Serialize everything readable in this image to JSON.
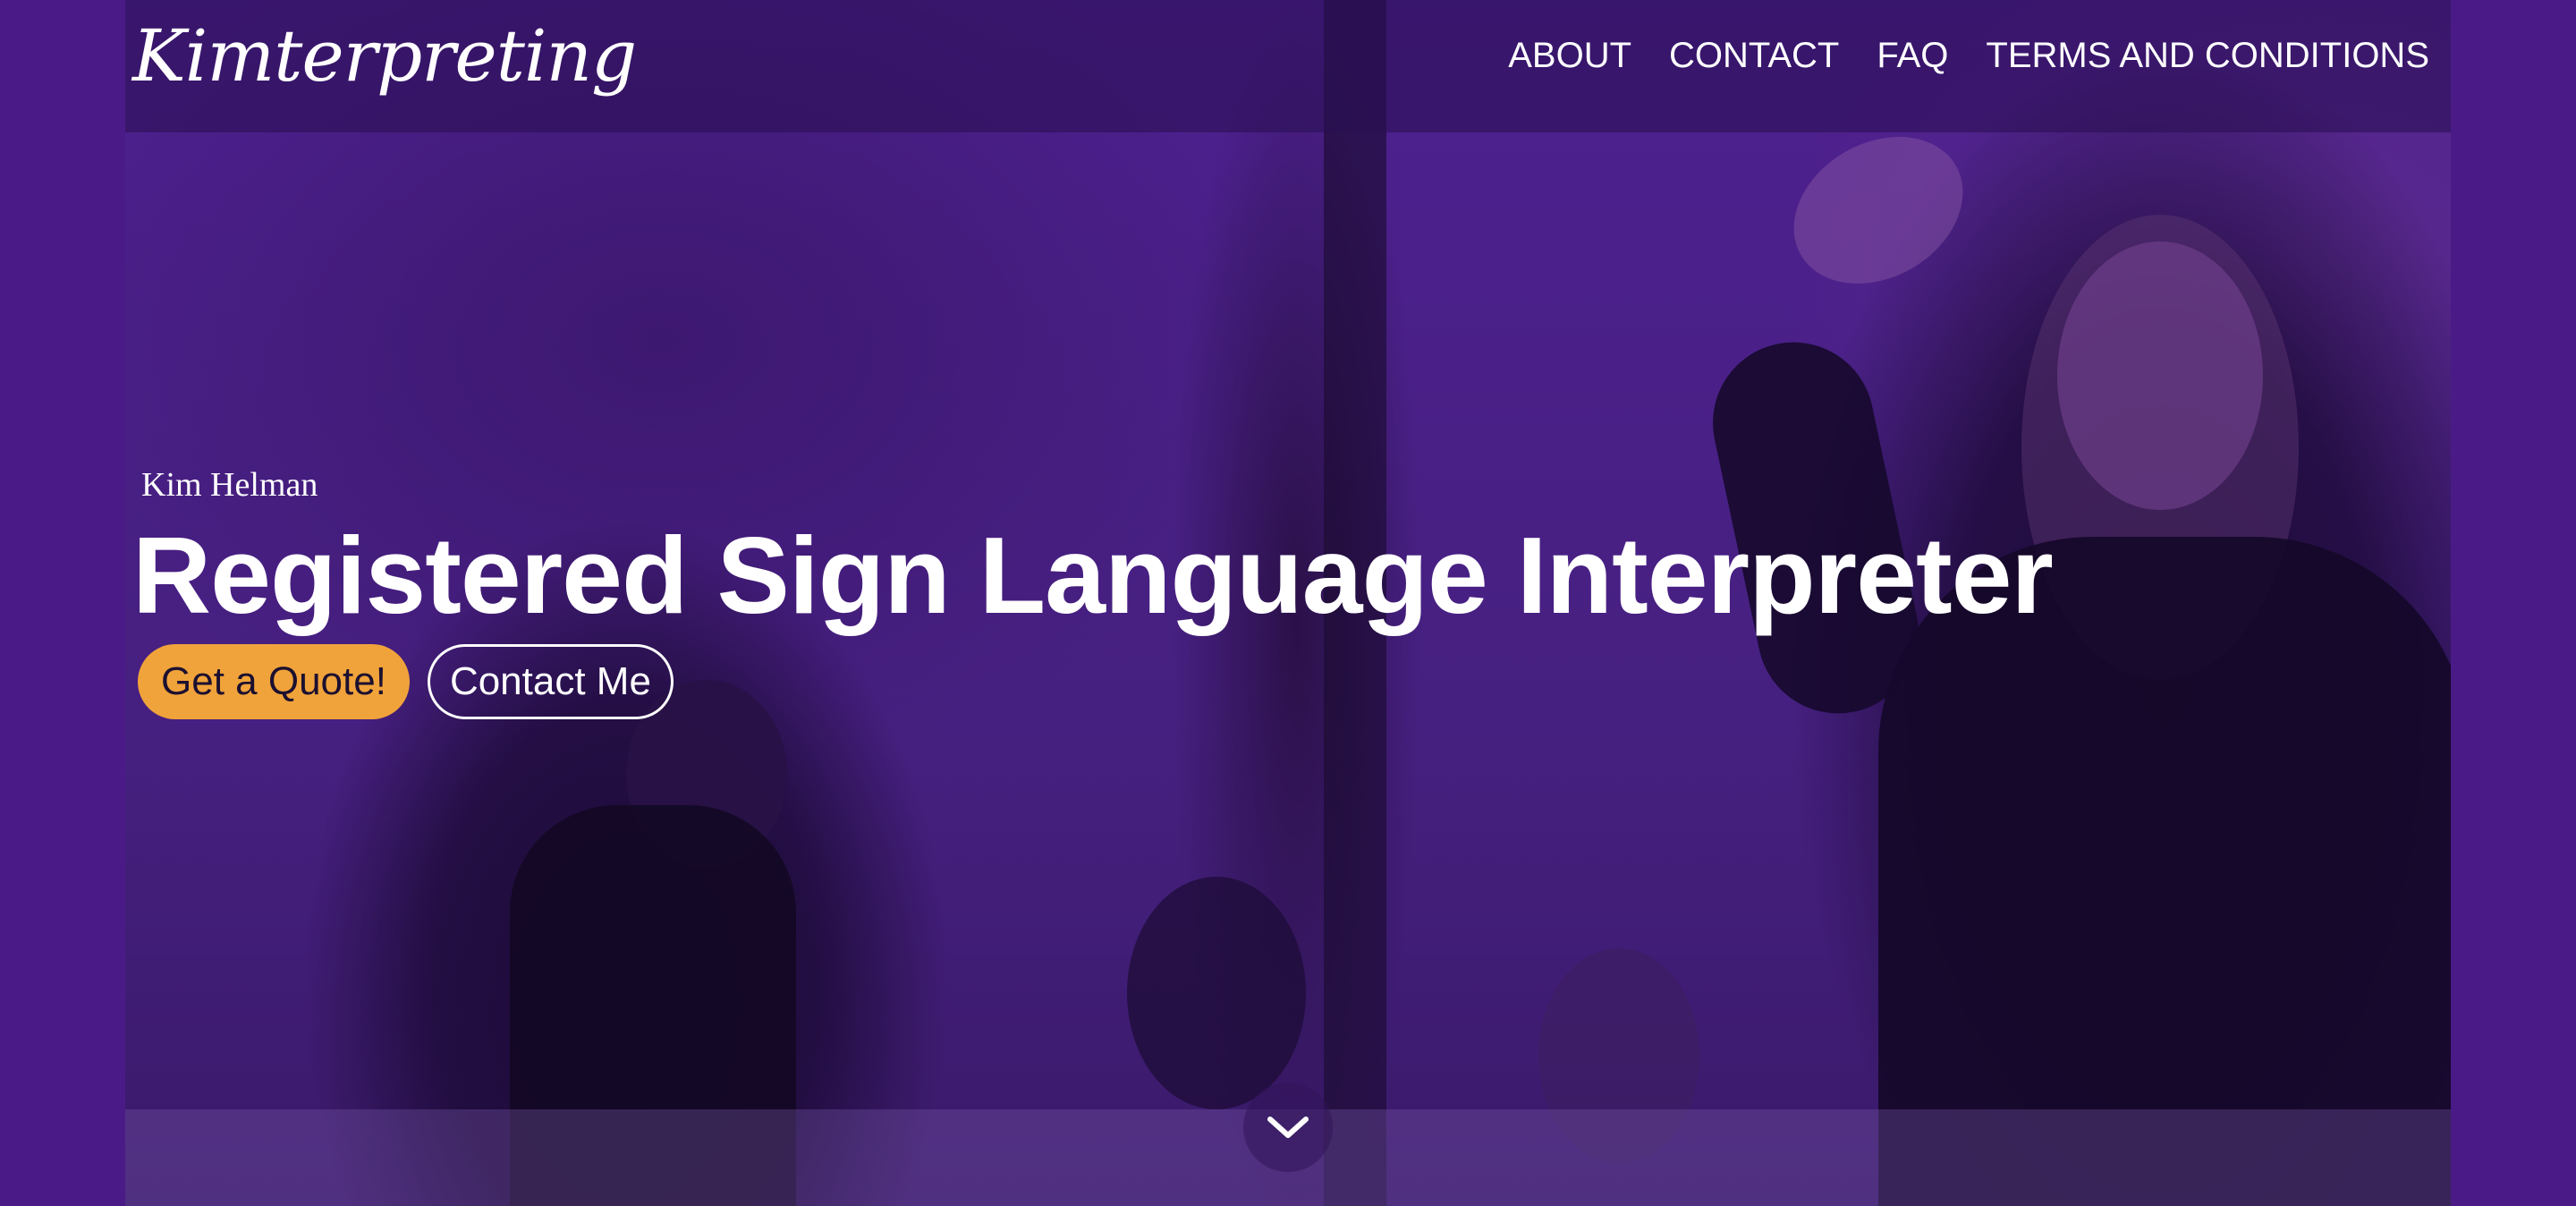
{
  "brand": {
    "logo_text": "Kimterpreting"
  },
  "nav": {
    "links": [
      {
        "label": "ABOUT"
      },
      {
        "label": "CONTACT"
      },
      {
        "label": "FAQ"
      },
      {
        "label": "TERMS AND CONDITIONS"
      }
    ]
  },
  "hero": {
    "subtitle": "Kim Helman",
    "headline": "Registered Sign Language Interpreter",
    "buttons": {
      "quote_label": "Get a Quote!",
      "contact_label": "Contact Me"
    },
    "scroll_icon": "chevron-down-icon"
  },
  "colors": {
    "overlay": "#4a1b86",
    "accent": "#f0a33a",
    "text": "#ffffff"
  }
}
